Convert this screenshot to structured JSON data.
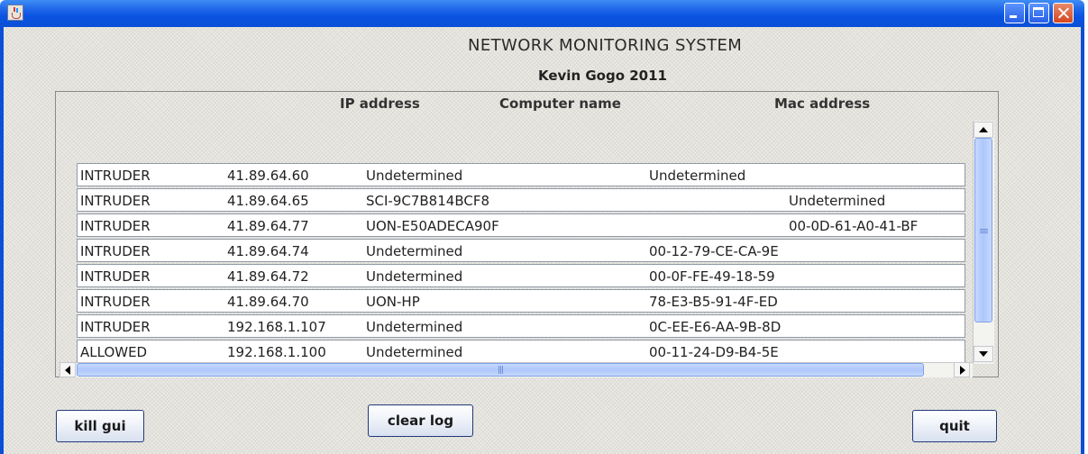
{
  "window": {
    "title": ""
  },
  "header": {
    "title": "NETWORK MONITORING SYSTEM",
    "author": "Kevin Gogo 2011"
  },
  "table": {
    "columns": [
      "IP address",
      "Computer name",
      "Mac address"
    ],
    "rows": [
      {
        "status": "INTRUDER",
        "ip": "41.89.64.60",
        "name": "Undetermined",
        "mac": "Undetermined"
      },
      {
        "status": "INTRUDER",
        "ip": "41.89.64.65",
        "name": "SCI-9C7B814BCF8",
        "mac": "Undetermined"
      },
      {
        "status": "INTRUDER",
        "ip": "41.89.64.77",
        "name": "UON-E50ADECA90F",
        "mac": "00-0D-61-A0-41-BF"
      },
      {
        "status": "INTRUDER",
        "ip": "41.89.64.74",
        "name": "Undetermined",
        "mac": "00-12-79-CE-CA-9E"
      },
      {
        "status": "INTRUDER",
        "ip": "41.89.64.72",
        "name": "Undetermined",
        "mac": "00-0F-FE-49-18-59"
      },
      {
        "status": "INTRUDER",
        "ip": "41.89.64.70",
        "name": "UON-HP",
        "mac": "78-E3-B5-91-4F-ED"
      },
      {
        "status": "INTRUDER",
        "ip": "192.168.1.107",
        "name": "Undetermined",
        "mac": "0C-EE-E6-AA-9B-8D"
      },
      {
        "status": "ALLOWED",
        "ip": "192.168.1.100",
        "name": "Undetermined",
        "mac": "00-11-24-D9-B4-5E"
      }
    ]
  },
  "buttons": {
    "kill": "kill gui",
    "clear": "clear log",
    "quit": "quit"
  },
  "colors": {
    "titlebar": "#0a4fd6",
    "close": "#d5461e",
    "content_bg": "#eceae4",
    "button_border": "#1f3a7a"
  },
  "icons": {
    "app": "java-app-icon",
    "minimize": "minimize-icon",
    "maximize": "maximize-icon",
    "close": "close-icon"
  }
}
